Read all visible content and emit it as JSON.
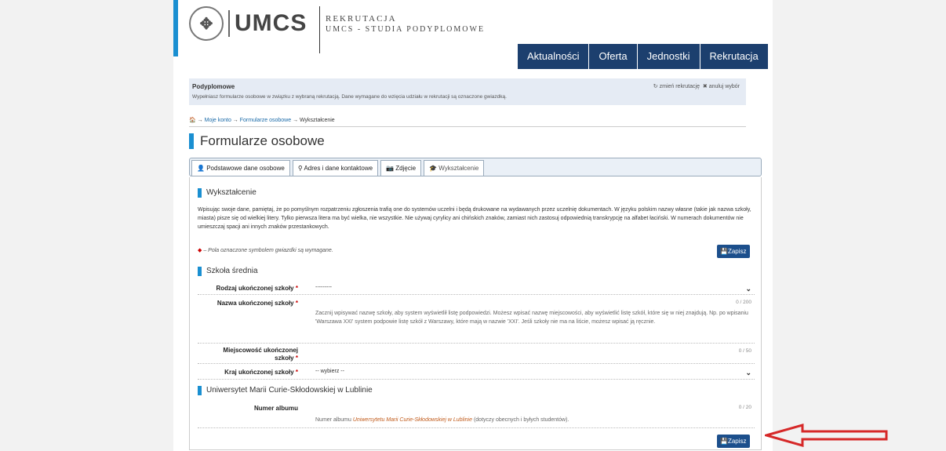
{
  "header": {
    "logo_text": "UMCS",
    "site_title_1": "REKRUTACJA",
    "site_title_2": "UMCS - STUDIA PODYPLOMOWE"
  },
  "nav": {
    "items": [
      {
        "label": "Aktualności"
      },
      {
        "label": "Oferta"
      },
      {
        "label": "Jednostki"
      },
      {
        "label": "Rekrutacja"
      }
    ]
  },
  "notice": {
    "heading": "Podyplomowe",
    "text": "Wypełniasz formularze osobowe w związku z wybraną rekrutacją. Dane wymagane do wzięcia udziału w rekrutacji są oznaczone gwiazdką.",
    "change": "zmień rekrutację",
    "cancel": "anuluj wybór"
  },
  "breadcrumb": {
    "item1": "Moje konto",
    "item2": "Formularze osobowe",
    "item3": "Wykształcenie"
  },
  "page_title": "Formularze osobowe",
  "tabs": [
    {
      "label": "Podstawowe dane osobowe"
    },
    {
      "label": "Adres i dane kontaktowe"
    },
    {
      "label": "Zdjęcie"
    },
    {
      "label": "Wykształcenie"
    }
  ],
  "education": {
    "title": "Wykształcenie",
    "intro": "Wpisując swoje dane, pamiętaj, że po pomyślnym rozpatrzeniu zgłoszenia trafią one do systemów uczelni i będą drukowane na wydawanych przez uczelnię dokumentach. W języku polskim nazwy własne (takie jak nazwa szkoły, miasta) pisze się od wielkiej litery. Tylko pierwsza litera ma być wielka, nie wszystkie. Nie używaj cyrylicy ani chińskich znaków, zamiast nich zastosuj odpowiednią transkrypcję na alfabet łaciński. W numerach dokumentów nie umieszczaj spacji ani innych znaków przestankowych.",
    "required_note": "– Pola oznaczone symbolem gwiazdki są wymagane.",
    "save_label": "Zapisz"
  },
  "high_school": {
    "title": "Szkoła średnia",
    "school_type_label": "Rodzaj ukończonej szkoły",
    "school_type_value": "---------",
    "school_name_label": "Nazwa ukończonej szkoły",
    "school_name_counter": "0 / 200",
    "school_name_help": "Zacznij wpisywać nazwę szkoły, aby system wyświetlił listę podpowiedzi. Możesz wpisać nazwę miejscowości, aby wyświetlić listę szkół, które się w niej znajdują. Np. po wpisaniu 'Warszawa XXI' system podpowie listę szkół z Warszawy, które mają w nazwie 'XXI'. Jeśli szkoły nie ma na liście, możesz wpisać ją ręcznie.",
    "city_label_1": "Miejscowość ukończonej",
    "city_label_2": "szkoły",
    "city_counter": "0 / 50",
    "country_label": "Kraj ukończonej szkoły",
    "country_value": "-- wybierz --"
  },
  "university": {
    "title": "Uniwersytet Marii Curie-Skłodowskiej w Lublinie",
    "album_label": "Numer albumu",
    "album_counter": "0 / 20",
    "album_help_pre": "Numer albumu",
    "album_help_link": "Uniwersytetu Marii Curie-Skłodowskiej w Lublinie",
    "album_help_post": "(dotyczy obecnych i byłych studentów)."
  },
  "colors": {
    "accent": "#1a8fd1",
    "nav": "#1c3f6e",
    "arrow": "#d62828"
  }
}
